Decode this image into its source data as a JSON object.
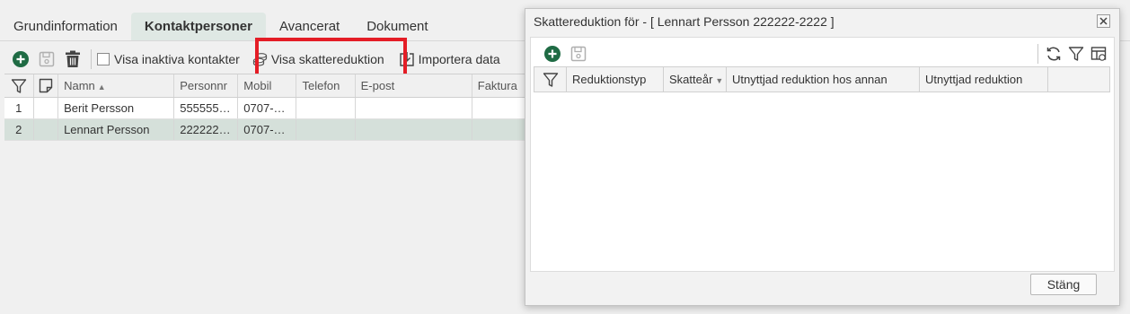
{
  "tabs": [
    {
      "label": "Grundinformation",
      "active": false
    },
    {
      "label": "Kontaktpersoner",
      "active": true
    },
    {
      "label": "Avancerat",
      "active": false
    },
    {
      "label": "Dokument",
      "active": false
    }
  ],
  "toolbar": {
    "icons": [
      "add-icon",
      "save-icon",
      "delete-icon"
    ],
    "show_inactive_label": "Visa inaktiva kontakter",
    "show_inactive_checked": false,
    "tax_reduction_label": "Visa skattereduktion",
    "import_label": "Importera data"
  },
  "grid": {
    "columns": [
      "Namn",
      "Personnr",
      "Mobil",
      "Telefon",
      "E-post",
      "Faktura"
    ],
    "sort_column": "Namn",
    "rows": [
      {
        "num": "1",
        "name": "Berit Persson",
        "pnr": "555555…",
        "mobile": "0707-…",
        "phone": "",
        "email": "",
        "invoice": "",
        "selected": false
      },
      {
        "num": "2",
        "name": "Lennart Persson",
        "pnr": "222222…",
        "mobile": "0707-…",
        "phone": "",
        "email": "",
        "invoice": "",
        "selected": true
      }
    ]
  },
  "dialog": {
    "title": "Skattereduktion för - [ Lennart Persson 222222-2222 ]",
    "columns": [
      "Reduktionstyp",
      "Skatteår",
      "Utnyttjad reduktion hos annan",
      "Utnyttjad reduktion"
    ],
    "rows": [],
    "close_label": "Stäng"
  },
  "colors": {
    "accent_green": "#1f6b44",
    "highlight_red": "#e41d26",
    "selected_row": "#d5e0da",
    "active_tab": "#dfe8e4"
  }
}
